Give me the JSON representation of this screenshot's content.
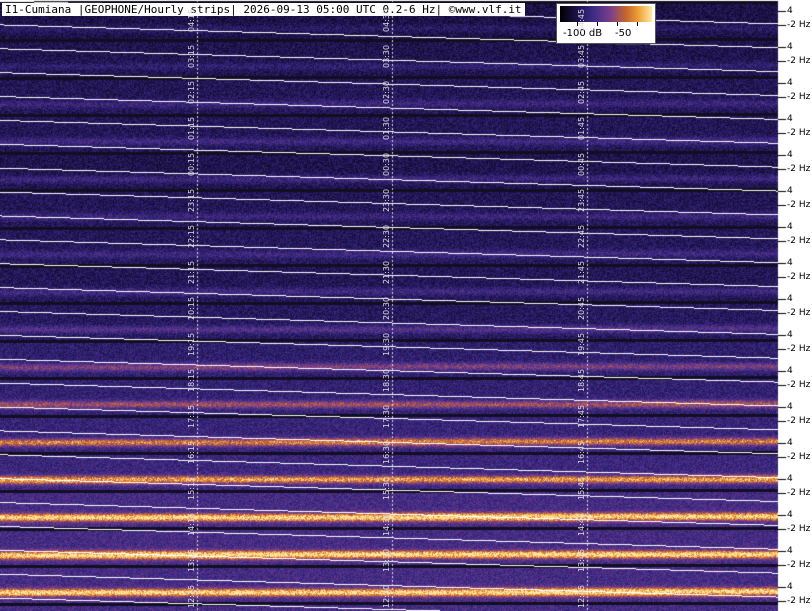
{
  "chart_data": {
    "type": "heatmap",
    "title": "I1-Cumiana |GEOPHONE/Hourly strips| 2026-09-13 05:00 UTC 0.2-6 Hz| ©www.vlf.it",
    "colorbar": {
      "labels": [
        "-100 dB",
        "-50"
      ],
      "range_db": [
        -120,
        -30
      ]
    },
    "y_ticks": [
      "4",
      "2 Hz"
    ],
    "strips": [
      {
        "hour": "04",
        "labels": [
          "04:15",
          "04:30",
          "04:45"
        ],
        "background_level": 0.18,
        "band_level": 0.1,
        "partial": true
      },
      {
        "hour": "03",
        "labels": [
          "03:15",
          "03:30",
          "03:45"
        ],
        "background_level": 0.2,
        "band_level": 0.12
      },
      {
        "hour": "02",
        "labels": [
          "02:15",
          "02:30",
          "02:45"
        ],
        "background_level": 0.22,
        "band_level": 0.15
      },
      {
        "hour": "01",
        "labels": [
          "01:15",
          "01:30",
          "01:45"
        ],
        "background_level": 0.22,
        "band_level": 0.18
      },
      {
        "hour": "00",
        "labels": [
          "00:15",
          "00:30",
          "00:45"
        ],
        "background_level": 0.2,
        "band_level": 0.18
      },
      {
        "hour": "23",
        "labels": [
          "23:15",
          "23:30",
          "23:45"
        ],
        "background_level": 0.22,
        "band_level": 0.15
      },
      {
        "hour": "22",
        "labels": [
          "22:15",
          "22:30",
          "22:45"
        ],
        "background_level": 0.23,
        "band_level": 0.16
      },
      {
        "hour": "21",
        "labels": [
          "21:15",
          "21:30",
          "21:45"
        ],
        "background_level": 0.22,
        "band_level": 0.18
      },
      {
        "hour": "20",
        "labels": [
          "20:15",
          "20:30",
          "20:45"
        ],
        "background_level": 0.24,
        "band_level": 0.24
      },
      {
        "hour": "19",
        "labels": [
          "19:15",
          "19:30",
          "19:45"
        ],
        "background_level": 0.28,
        "band_level": 0.34
      },
      {
        "hour": "18",
        "labels": [
          "18:15",
          "18:30",
          "18:45"
        ],
        "background_level": 0.3,
        "band_level": 0.42
      },
      {
        "hour": "17",
        "labels": [
          "17:15",
          "17:30",
          "17:45"
        ],
        "background_level": 0.32,
        "band_level": 0.58
      },
      {
        "hour": "16",
        "labels": [
          "16:15",
          "16:30",
          "16:45"
        ],
        "background_level": 0.34,
        "band_level": 0.66
      },
      {
        "hour": "15",
        "labels": [
          "15:15",
          "15:30",
          "15:45"
        ],
        "background_level": 0.38,
        "band_level": 0.8
      },
      {
        "hour": "14",
        "labels": [
          "14:15",
          "14:30",
          "14:45"
        ],
        "background_level": 0.38,
        "band_level": 0.82
      },
      {
        "hour": "13",
        "labels": [
          "13:15",
          "13:30",
          "13:45"
        ],
        "background_level": 0.38,
        "band_level": 0.8
      },
      {
        "hour": "12",
        "labels": [
          "12:15",
          "12:30",
          "12:45"
        ],
        "background_level": 0.38,
        "band_level": 0.76,
        "partial": true
      }
    ]
  }
}
